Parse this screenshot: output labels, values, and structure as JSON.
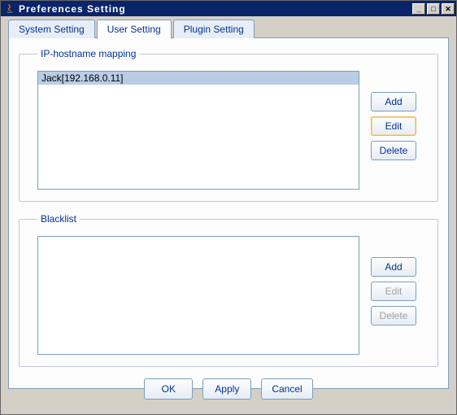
{
  "window": {
    "title": "Preferences Setting"
  },
  "titlebar_buttons": {
    "minimize": "_",
    "maximize": "□",
    "close": "✕"
  },
  "tabs": {
    "system": "System Setting",
    "user": "User Setting",
    "plugin": "Plugin Setting"
  },
  "sections": {
    "mapping": {
      "legend": "IP-hostname mapping",
      "items": [
        "Jack[192.168.0.11]"
      ],
      "buttons": {
        "add": "Add",
        "edit": "Edit",
        "delete": "Delete"
      }
    },
    "blacklist": {
      "legend": "Blacklist",
      "items": [],
      "buttons": {
        "add": "Add",
        "edit": "Edit",
        "delete": "Delete"
      }
    }
  },
  "footer": {
    "ok": "OK",
    "apply": "Apply",
    "cancel": "Cancel"
  }
}
